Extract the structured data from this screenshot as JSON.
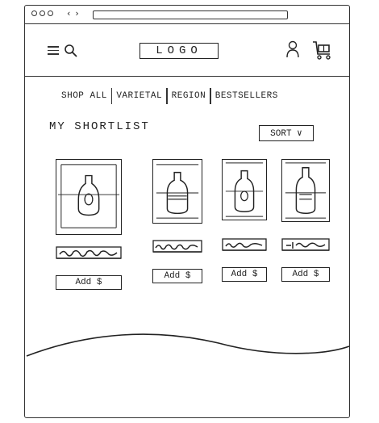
{
  "header": {
    "logo_label": "LOGO"
  },
  "nav": {
    "items": [
      {
        "label": "SHOP ALL"
      },
      {
        "label": "VARIETAL"
      },
      {
        "label": "REGION"
      },
      {
        "label": "BESTSELLERS"
      }
    ]
  },
  "shortlist": {
    "title": "MY SHORTLIST",
    "sort_label": "SORT ∨"
  },
  "products": [
    {
      "add_label": "Add $"
    },
    {
      "add_label": "Add $"
    },
    {
      "add_label": "Add $"
    },
    {
      "add_label": "Add $"
    }
  ],
  "icons": {
    "menu": "hamburger-icon",
    "search": "search-icon",
    "user": "user-icon",
    "cart": "cart-icon",
    "product": "bottle-icon"
  }
}
